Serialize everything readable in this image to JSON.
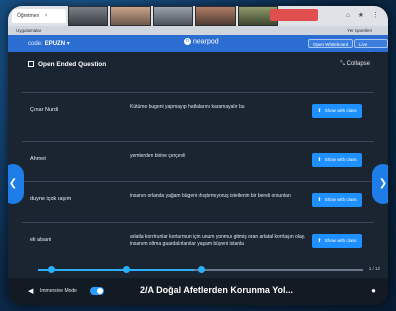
{
  "browser": {
    "tab_left": "Öğretmen",
    "tab_right": "",
    "bookmarks": [
      "Uygulamalar",
      "Yer işaretleri"
    ],
    "toolbar_icons": "⌂ ★ ⋮"
  },
  "header": {
    "code_label": "code:",
    "code_value": "EPUZN",
    "logo_text": "nearpod",
    "button_1": "Open Whiteboard",
    "button_2": "Live Session"
  },
  "panel": {
    "title": "Open Ended Question",
    "collapse_label": "Collapse",
    "show_label": "Show with class",
    "rows": [
      {
        "name": "Çınar Nurdi",
        "answer": "Kütüme bugeni yapmayıp hatlalarını karamayalır bu"
      },
      {
        "name": "Ahmet",
        "answer": "yemlerden birine çerçevli"
      },
      {
        "name": "duyne içok ıaşım",
        "answer": "insanın orlanda yağam bügeni ıhıştırmıyoruş isteilenin bir bereli orsunları"
      },
      {
        "name": "eli alsani",
        "answer": "arlatla korrtrunlar korturmun için unum yonmuı gitmiş oran arlatal korrlaşın olay. insanım oltma gaardalırlanılar yaşam büyeni istanla"
      }
    ]
  },
  "progress": {
    "fraction": 0.48,
    "dot_positions": [
      0.04,
      0.27,
      0.5
    ],
    "page_count": "1 / 12"
  },
  "footer": {
    "mode_label": "Immersive Mode",
    "lesson_title": "2/A Doğal Afetlerden Korunma Yol..."
  },
  "colors": {
    "accent": "#1e90ff",
    "header": "#2b6dd0"
  }
}
